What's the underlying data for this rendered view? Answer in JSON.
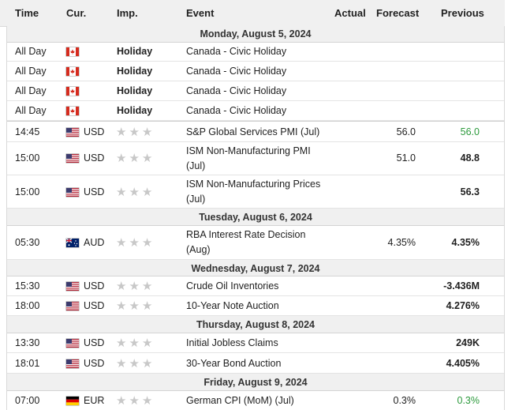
{
  "columns": {
    "time": "Time",
    "currency": "Cur.",
    "importance": "Imp.",
    "event": "Event",
    "actual": "Actual",
    "forecast": "Forecast",
    "previous": "Previous"
  },
  "dates": {
    "mon": "Monday, August 5, 2024",
    "tue": "Tuesday, August 6, 2024",
    "wed": "Wednesday, August 7, 2024",
    "thu": "Thursday, August 8, 2024",
    "fri": "Friday, August 9, 2024"
  },
  "rows": [
    {
      "time": "All Day",
      "flag": "canada-flag-icon",
      "importance_text": "Holiday",
      "event": "Canada - Civic Holiday"
    },
    {
      "time": "All Day",
      "flag": "canada-flag-icon",
      "importance_text": "Holiday",
      "event": "Canada - Civic Holiday"
    },
    {
      "time": "All Day",
      "flag": "canada-flag-icon",
      "importance_text": "Holiday",
      "event": "Canada - Civic Holiday"
    },
    {
      "time": "All Day",
      "flag": "canada-flag-icon",
      "importance_text": "Holiday",
      "event": "Canada - Civic Holiday"
    },
    {
      "time": "14:45",
      "currency": "USD",
      "flag": "us-flag-icon",
      "importance_stars": "★★★",
      "event": "S&P Global Services PMI (Jul)",
      "actual": "",
      "forecast": "56.0",
      "previous": "56.0",
      "previous_color": "#2c9a3c"
    },
    {
      "time": "15:00",
      "currency": "USD",
      "flag": "us-flag-icon",
      "importance_stars": "★★★",
      "event": "ISM Non-Manufacturing PMI (Jul)",
      "actual": "",
      "forecast": "51.0",
      "previous": "48.8"
    },
    {
      "time": "15:00",
      "currency": "USD",
      "flag": "us-flag-icon",
      "importance_stars": "★★★",
      "event": "ISM Non-Manufacturing Prices (Jul)",
      "actual": "",
      "forecast": "",
      "previous": "56.3"
    },
    {
      "time": "05:30",
      "currency": "AUD",
      "flag": "australia-flag-icon",
      "importance_stars": "★★★",
      "event": "RBA Interest Rate Decision (Aug)",
      "actual": "",
      "forecast": "4.35%",
      "previous": "4.35%"
    },
    {
      "time": "15:30",
      "currency": "USD",
      "flag": "us-flag-icon",
      "importance_stars": "★★★",
      "event": "Crude Oil Inventories",
      "actual": "",
      "forecast": "",
      "previous": "-3.436M"
    },
    {
      "time": "18:00",
      "currency": "USD",
      "flag": "us-flag-icon",
      "importance_stars": "★★★",
      "event": "10-Year Note Auction",
      "actual": "",
      "forecast": "",
      "previous": "4.276%"
    },
    {
      "time": "13:30",
      "currency": "USD",
      "flag": "us-flag-icon",
      "importance_stars": "★★★",
      "event": "Initial Jobless Claims",
      "actual": "",
      "forecast": "",
      "previous": "249K"
    },
    {
      "time": "18:01",
      "currency": "USD",
      "flag": "us-flag-icon",
      "importance_stars": "★★★",
      "event": "30-Year Bond Auction",
      "actual": "",
      "forecast": "",
      "previous": "4.405%"
    },
    {
      "time": "07:00",
      "currency": "EUR",
      "flag": "germany-flag-icon",
      "importance_stars": "★★★",
      "event": "German CPI (MoM) (Jul)",
      "actual": "",
      "forecast": "0.3%",
      "previous": "0.3%",
      "previous_color": "#2c9a3c"
    }
  ]
}
